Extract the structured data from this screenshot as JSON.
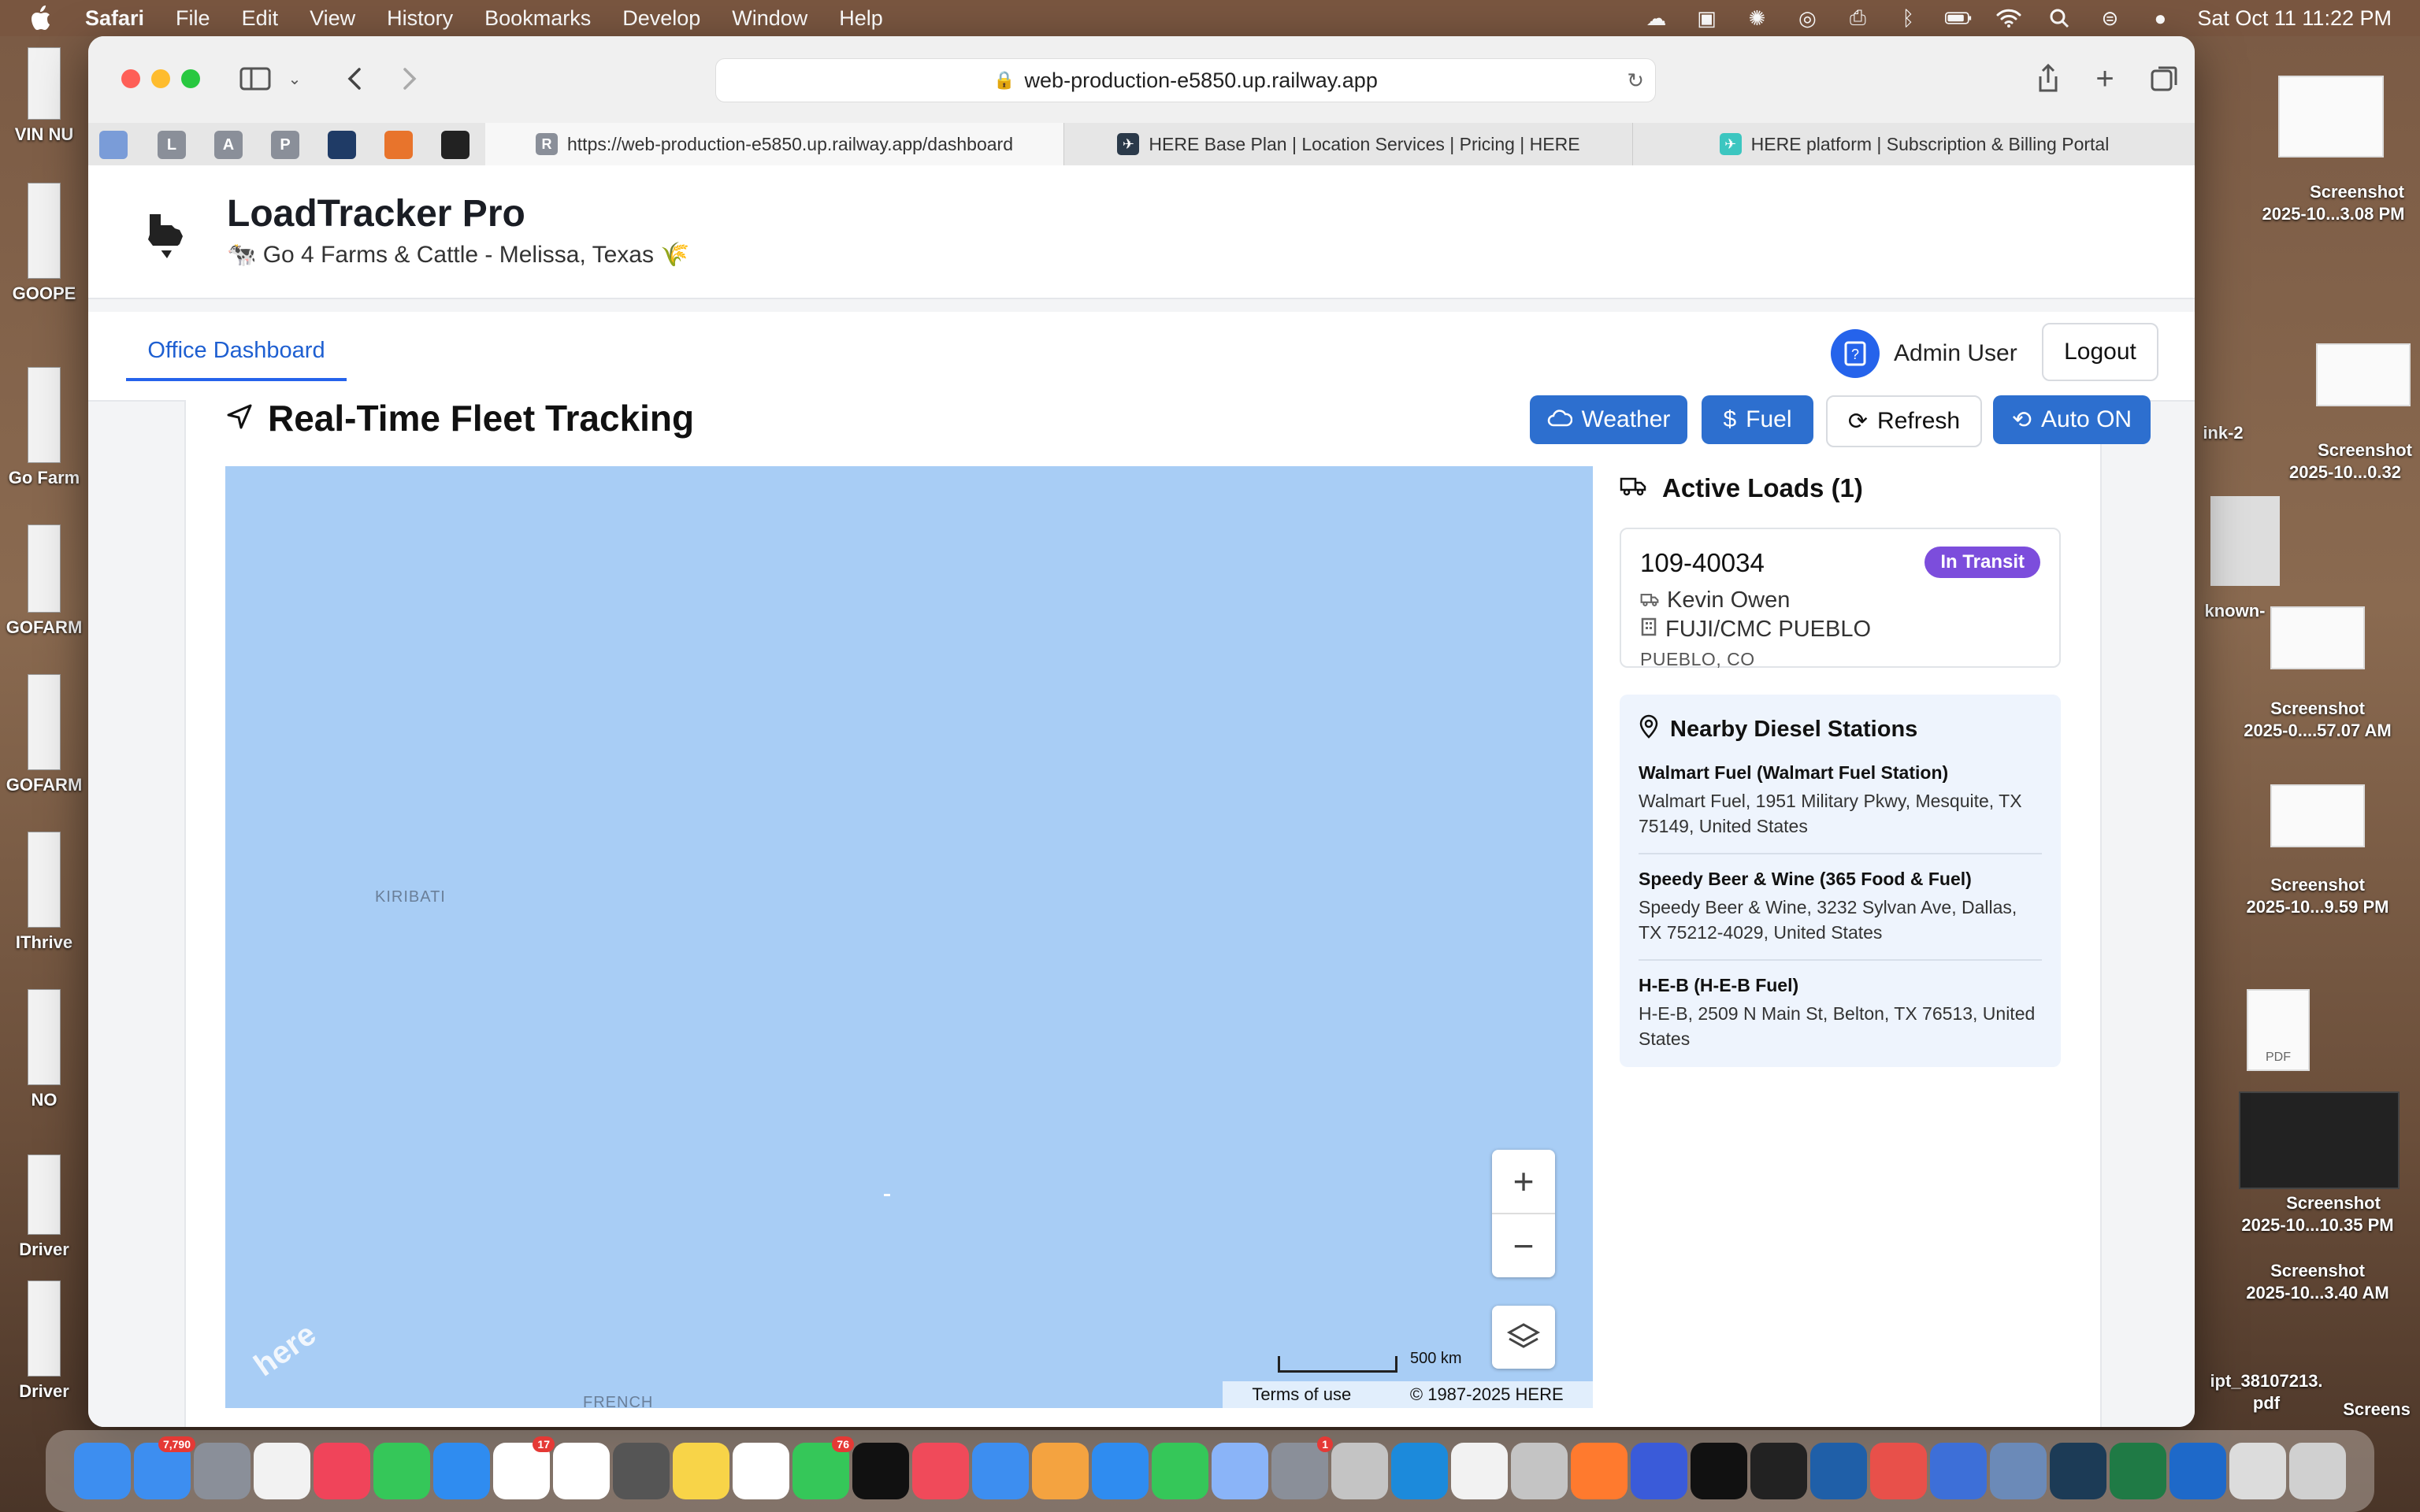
{
  "menubar": {
    "app_name": "Safari",
    "items": [
      "File",
      "Edit",
      "View",
      "History",
      "Bookmarks",
      "Develop",
      "Window",
      "Help"
    ],
    "clock": "Sat Oct 11  11:22 PM"
  },
  "desktop_left": [
    {
      "label": "VIN NU"
    },
    {
      "label": "GOOPE"
    },
    {
      "label": "Go Farm"
    },
    {
      "label": "GOFARM"
    },
    {
      "label": "GOFARM"
    },
    {
      "label": "IThrive"
    },
    {
      "label": "NO"
    },
    {
      "label": "Driver"
    },
    {
      "label": "Driver"
    }
  ],
  "desktop_right": [
    {
      "label": "Screenshot"
    },
    {
      "label": "2025-10...3.08 PM"
    },
    {
      "label": "Screenshot"
    },
    {
      "label": "2025-10...0.32"
    },
    {
      "label": "ink-2"
    },
    {
      "label": "known-"
    },
    {
      "label": "Screenshot"
    },
    {
      "label": "2025-0....57.07 AM"
    },
    {
      "label": "Screenshot"
    },
    {
      "label": "2025-10...9.59 PM"
    },
    {
      "label": "PDF"
    },
    {
      "label": "Screenshot"
    },
    {
      "label": "2025-10...10.35 PM"
    },
    {
      "label": "Screenshot"
    },
    {
      "label": "2025-10...3.40 AM"
    },
    {
      "label": "ipt_38107213."
    },
    {
      "label": "pdf"
    },
    {
      "label": "Screens"
    }
  ],
  "browser": {
    "url": "web-production-e5850.up.railway.app",
    "pinned_tabs": [
      {
        "letter": "",
        "color": "#7a9cd8"
      },
      {
        "letter": "L",
        "color": "#8a8f99"
      },
      {
        "letter": "A",
        "color": "#8a8f99"
      },
      {
        "letter": "P",
        "color": "#8a8f99"
      },
      {
        "letter": "",
        "color": "#1f3b66"
      },
      {
        "letter": "",
        "color": "#e8742c"
      },
      {
        "letter": "",
        "color": "#222222"
      }
    ],
    "tabs": [
      {
        "title": "https://web-production-e5850.up.railway.app/dashboard",
        "fav": "R",
        "active": true
      },
      {
        "title": "HERE Base Plan | Location Services | Pricing | HERE",
        "fav": "",
        "active": false
      },
      {
        "title": "HERE platform | Subscription & Billing Portal",
        "fav": "",
        "active": false
      }
    ]
  },
  "app": {
    "title": "LoadTracker Pro",
    "subtitle": "🐄 Go 4 Farms & Cattle - Melissa, Texas 🌾",
    "nav_tab": "Office Dashboard",
    "user": "Admin User",
    "logout": "Logout"
  },
  "tracking": {
    "title": "Real-Time Fleet Tracking",
    "buttons": {
      "weather": "Weather",
      "fuel": "Fuel",
      "refresh": "Refresh",
      "auto": "Auto ON"
    }
  },
  "map": {
    "labels": {
      "kiribati": "KIRIBATI",
      "french": "FRENCH"
    },
    "scale": "500 km",
    "terms": "Terms of use",
    "copyright": "© 1987-2025 HERE",
    "logo": "here"
  },
  "active_loads": {
    "title": "Active Loads (1)",
    "loads": [
      {
        "id": "109-40034",
        "status": "In Transit",
        "driver": "Kevin Owen",
        "facility": "FUJI/CMC PUEBLO",
        "city": "PUEBLO, CO"
      }
    ]
  },
  "diesel": {
    "title": "Nearby Diesel Stations",
    "stations": [
      {
        "name": "Walmart Fuel (Walmart Fuel Station)",
        "address": "Walmart Fuel, 1951 Military Pkwy, Mesquite, TX 75149, United States"
      },
      {
        "name": "Speedy Beer & Wine (365 Food & Fuel)",
        "address": "Speedy Beer & Wine, 3232 Sylvan Ave, Dallas, TX 75212-4029, United States"
      },
      {
        "name": "H-E-B (H-E-B Fuel)",
        "address": "H-E-B, 2509 N Main St, Belton, TX 76513, United States"
      }
    ]
  },
  "dock": {
    "apps": [
      {
        "name": "finder",
        "color": "#3d8ef0"
      },
      {
        "name": "mail",
        "color": "#3d8ef0",
        "badge": "7,790"
      },
      {
        "name": "launchpad",
        "color": "#8a8f99"
      },
      {
        "name": "photos",
        "color": "#f2f2f2"
      },
      {
        "name": "music",
        "color": "#f0445a"
      },
      {
        "name": "facetime",
        "color": "#35c759"
      },
      {
        "name": "safari",
        "color": "#2f8cf0"
      },
      {
        "name": "reminders",
        "color": "#ffffff",
        "badge": "17"
      },
      {
        "name": "calendar",
        "color": "#ffffff"
      },
      {
        "name": "calculator",
        "color": "#555555"
      },
      {
        "name": "notes",
        "color": "#f8d448"
      },
      {
        "name": "freeform",
        "color": "#ffffff"
      },
      {
        "name": "messages",
        "color": "#35c759",
        "badge": "76"
      },
      {
        "name": "tv",
        "color": "#111111"
      },
      {
        "name": "news",
        "color": "#f04a5a"
      },
      {
        "name": "keynote",
        "color": "#3d8ef0"
      },
      {
        "name": "pages",
        "color": "#f4a340"
      },
      {
        "name": "app-store",
        "color": "#2f8cf0"
      },
      {
        "name": "numbers",
        "color": "#35c759"
      },
      {
        "name": "preview",
        "color": "#8ab4f8"
      },
      {
        "name": "settings",
        "color": "#8a8f99",
        "badge": "1"
      },
      {
        "name": "unknown-1",
        "color": "#c4c4c4"
      },
      {
        "name": "edge",
        "color": "#1c8adb"
      },
      {
        "name": "chrome",
        "color": "#f2f2f2"
      },
      {
        "name": "unknown-2",
        "color": "#c4c4c4"
      },
      {
        "name": "firefox",
        "color": "#ff7a2e"
      },
      {
        "name": "teams-blue",
        "color": "#3a5bd9"
      },
      {
        "name": "chatgpt",
        "color": "#111111"
      },
      {
        "name": "github",
        "color": "#222222"
      },
      {
        "name": "vscode",
        "color": "#1f5fa8"
      },
      {
        "name": "cloud",
        "color": "#e8504a"
      },
      {
        "name": "printer",
        "color": "#3d6fd8"
      },
      {
        "name": "system-info",
        "color": "#6b8ab8"
      },
      {
        "name": "perplexity",
        "color": "#1c3b56"
      },
      {
        "name": "excel",
        "color": "#1f7a45"
      },
      {
        "name": "outlook",
        "color": "#1e69c9"
      },
      {
        "name": "downloads",
        "color": "#dcdcdc"
      },
      {
        "name": "trash",
        "color": "#d0d0d0"
      }
    ]
  },
  "colors": {
    "brand_blue": "#2d6fcf",
    "status_purple": "#7c4ddc",
    "map_water": "#a8cdf5"
  }
}
